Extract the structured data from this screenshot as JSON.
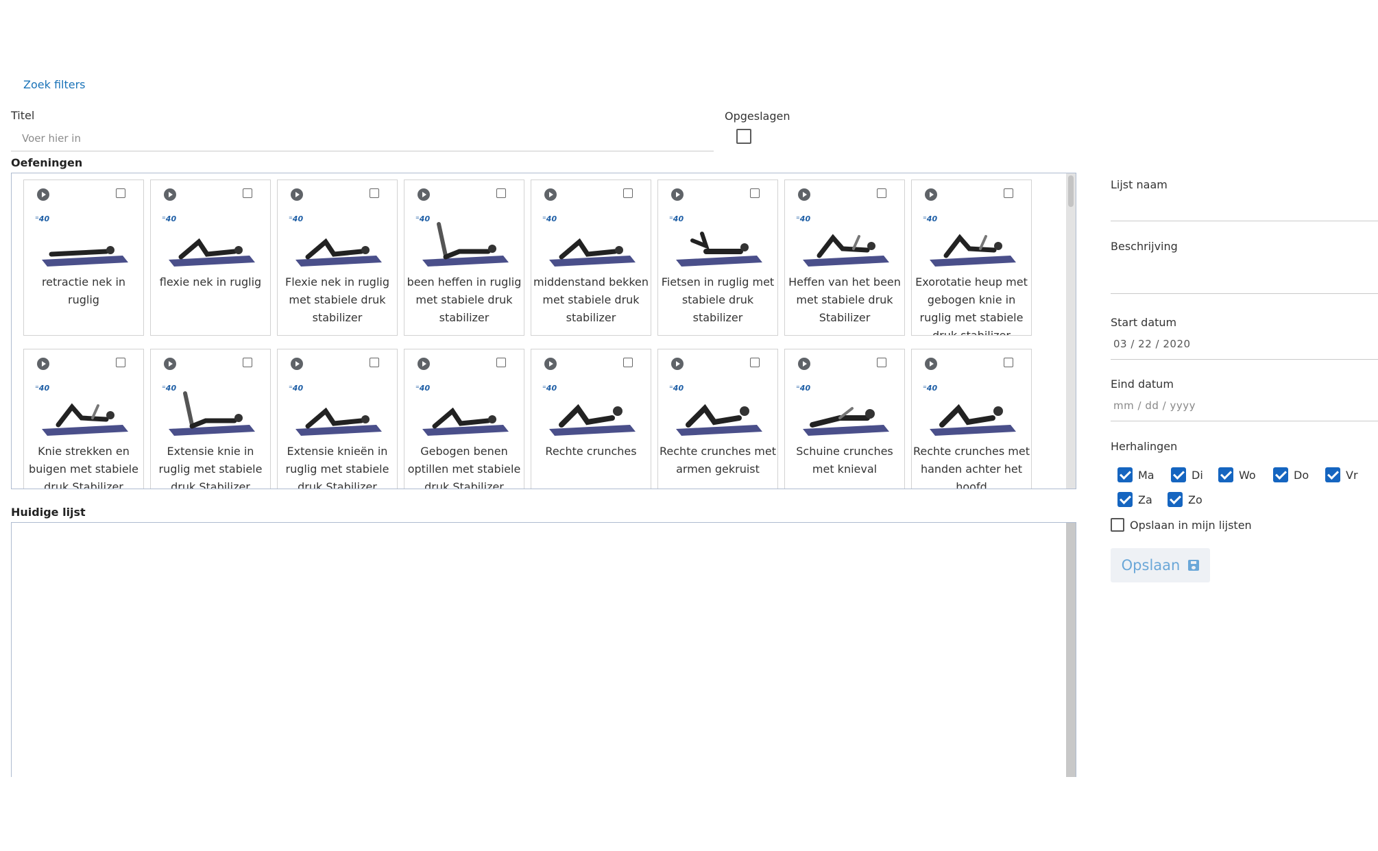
{
  "filters": {
    "link_label": "Zoek filters",
    "title_label": "Titel",
    "title_placeholder": "Voer hier in",
    "saved_label": "Opgeslagen"
  },
  "exercises_label": "Oefeningen",
  "brand_icon": "40-logo",
  "exercises": [
    {
      "name": "retractie nek in ruglig",
      "pose": "flat"
    },
    {
      "name": "flexie nek in ruglig",
      "pose": "knees"
    },
    {
      "name": "Flexie nek in ruglig met stabiele druk stabilizer",
      "pose": "knees"
    },
    {
      "name": "been heffen in ruglig met stabiele druk stabilizer",
      "pose": "leg-up"
    },
    {
      "name": "middenstand bekken met stabiele druk stabilizer",
      "pose": "knees"
    },
    {
      "name": "Fietsen in ruglig met stabiele druk stabilizer",
      "pose": "cycle"
    },
    {
      "name": "Heffen van het been met stabiele druk Stabilizer",
      "pose": "knee-up"
    },
    {
      "name": "Exorotatie heup met gebogen knie in ruglig met stabiele druk stabilizer",
      "pose": "knee-up"
    },
    {
      "name": "Knie strekken en buigen met stabiele druk Stabilizer",
      "pose": "knee-up"
    },
    {
      "name": "Extensie knie in ruglig met stabiele druk Stabilizer",
      "pose": "leg-up"
    },
    {
      "name": "Extensie knieën in ruglig met stabiele druk Stabilizer",
      "pose": "knees"
    },
    {
      "name": "Gebogen benen optillen met stabiele druk Stabilizer",
      "pose": "knees"
    },
    {
      "name": "Rechte crunches",
      "pose": "crunch"
    },
    {
      "name": "Rechte crunches met armen gekruist",
      "pose": "crunch"
    },
    {
      "name": "Schuine crunches met knieval",
      "pose": "twist"
    },
    {
      "name": "Rechte crunches met handen achter het hoofd",
      "pose": "crunch"
    }
  ],
  "current_list_label": "Huidige lijst",
  "panel": {
    "list_name_label": "Lijst naam",
    "description_label": "Beschrijving",
    "start_label": "Start datum",
    "start_value": "03 / 22 / 2020",
    "end_label": "Eind datum",
    "end_placeholder": "mm / dd / yyyy",
    "repeat_label": "Herhalingen",
    "days": [
      {
        "label": "Ma",
        "checked": true
      },
      {
        "label": "Di",
        "checked": true
      },
      {
        "label": "Wo",
        "checked": true
      },
      {
        "label": "Do",
        "checked": true
      },
      {
        "label": "Vr",
        "checked": true
      },
      {
        "label": "Za",
        "checked": true
      },
      {
        "label": "Zo",
        "checked": true
      }
    ],
    "save_in_lists_label": "Opslaan in mijn lijsten",
    "save_button": "Opslaan",
    "accent_color": "#1565c0",
    "mat_color": "#4a4f8a"
  }
}
